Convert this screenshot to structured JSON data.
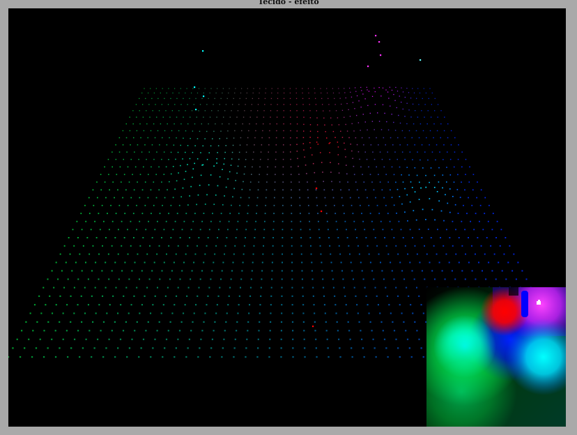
{
  "window": {
    "title": "Tecido - efeito"
  },
  "scene": {
    "background": "#000000",
    "frame_color": "#a9a9a9",
    "grid_columns": 48,
    "grid_rows": 36,
    "colors": {
      "green": "#00ff6a",
      "cyan": "#00ffff",
      "red": "#ff0000",
      "blue": "#0000ff",
      "magenta": "#ff33ff"
    }
  },
  "heatmap": {
    "blobs": [
      {
        "color": "#00ff88",
        "strength": 0.95,
        "position": "left"
      },
      {
        "color": "#00ffff",
        "strength": 1.0,
        "position": "left-center"
      },
      {
        "color": "#ff0000",
        "strength": 1.0,
        "position": "top-center"
      },
      {
        "color": "#0022ff",
        "strength": 1.0,
        "position": "top-center-right"
      },
      {
        "color": "#ff22ff",
        "strength": 1.0,
        "position": "top-right"
      },
      {
        "color": "#00ffff",
        "strength": 1.0,
        "position": "right-bottom"
      }
    ]
  }
}
